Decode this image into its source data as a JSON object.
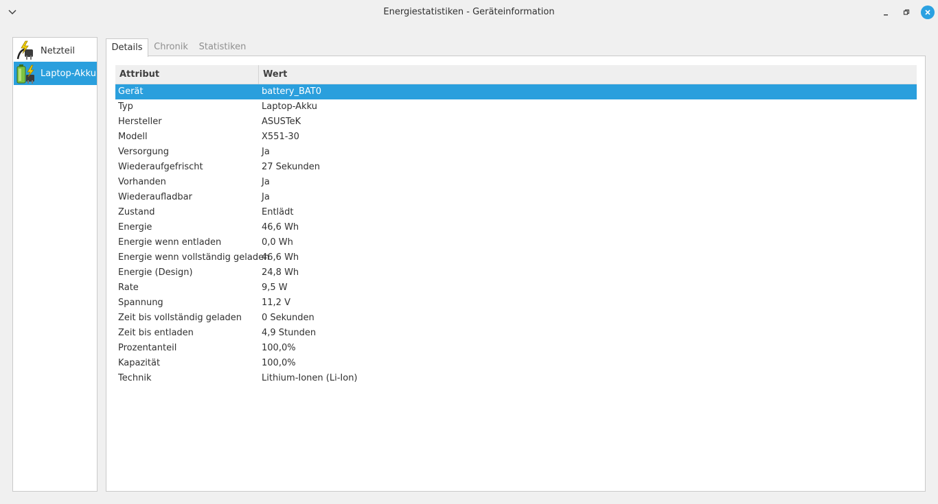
{
  "window": {
    "title": "Energiestatistiken - Geräteinformation",
    "icons": {
      "menu": "chevron-down-icon",
      "minimize": "minimize-icon",
      "maximize": "restore-icon",
      "close": "close-icon"
    },
    "accent": "#2a9fdd"
  },
  "sidebar": {
    "items": [
      {
        "label": "Netzteil",
        "icon": "power-supply-icon",
        "selected": false
      },
      {
        "label": "Laptop-Akku",
        "icon": "battery-icon",
        "selected": true
      }
    ]
  },
  "tabs": [
    {
      "label": "Details",
      "active": true
    },
    {
      "label": "Chronik",
      "active": false
    },
    {
      "label": "Statistiken",
      "active": false
    }
  ],
  "table": {
    "headers": [
      "Attribut",
      "Wert"
    ],
    "rows": [
      {
        "attr": "Gerät",
        "value": "battery_BAT0",
        "selected": true
      },
      {
        "attr": "Typ",
        "value": "Laptop-Akku"
      },
      {
        "attr": "Hersteller",
        "value": "ASUSTeK"
      },
      {
        "attr": "Modell",
        "value": "X551-30"
      },
      {
        "attr": "Versorgung",
        "value": "Ja"
      },
      {
        "attr": "Wiederaufgefrischt",
        "value": "27 Sekunden"
      },
      {
        "attr": "Vorhanden",
        "value": "Ja"
      },
      {
        "attr": "Wiederaufladbar",
        "value": "Ja"
      },
      {
        "attr": "Zustand",
        "value": "Entlädt"
      },
      {
        "attr": "Energie",
        "value": "46,6 Wh"
      },
      {
        "attr": "Energie wenn entladen",
        "value": "0,0 Wh"
      },
      {
        "attr": "Energie wenn vollständig geladen",
        "value": "46,6 Wh"
      },
      {
        "attr": "Energie (Design)",
        "value": "24,8 Wh"
      },
      {
        "attr": "Rate",
        "value": "9,5 W"
      },
      {
        "attr": "Spannung",
        "value": "11,2 V"
      },
      {
        "attr": "Zeit bis vollständig geladen",
        "value": "0 Sekunden"
      },
      {
        "attr": "Zeit bis entladen",
        "value": "4,9 Stunden"
      },
      {
        "attr": "Prozentanteil",
        "value": "100,0%"
      },
      {
        "attr": "Kapazität",
        "value": "100,0%"
      },
      {
        "attr": "Technik",
        "value": "Lithium-Ionen (Li-Ion)"
      }
    ]
  }
}
